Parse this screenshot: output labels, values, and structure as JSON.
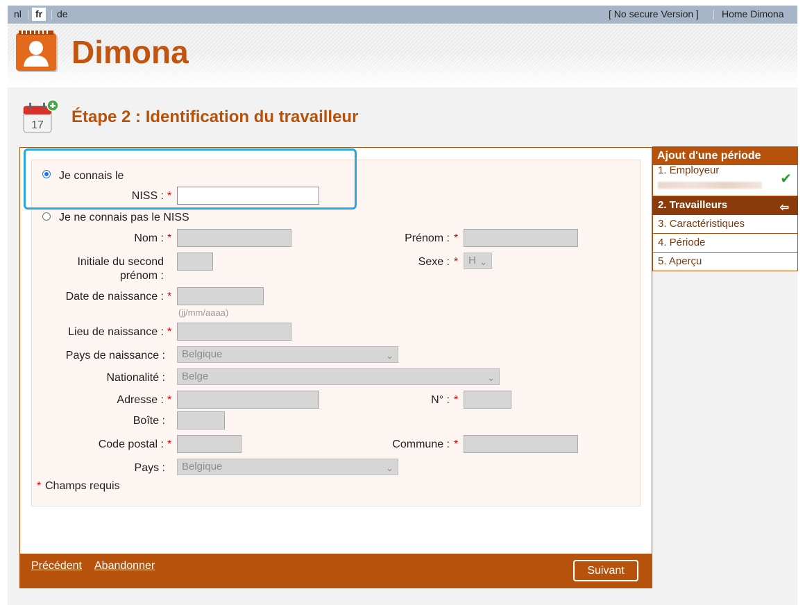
{
  "top_bar": {
    "languages": [
      "nl",
      "fr",
      "de"
    ],
    "active_language": "fr",
    "security_notice": "[ No secure Version ]",
    "home_link": "Home Dimona"
  },
  "brand": {
    "name": "Dimona"
  },
  "step": {
    "title": "Étape 2 : Identification du travailleur",
    "calendar_day": "17"
  },
  "form": {
    "known_niss_label": "Je connais le",
    "niss_label": "NISS :",
    "niss_value": "",
    "unknown_niss_label": "Je ne connais pas le NISS",
    "nom_label": "Nom :",
    "prenom_label": "Prénom :",
    "initial_label_1": "Initiale du second",
    "initial_label_2": "prénom :",
    "sexe_label": "Sexe :",
    "sexe_value": "H",
    "dob_label": "Date de naissance :",
    "dob_hint": "(jj/mm/aaaa)",
    "birthplace_label": "Lieu de naissance :",
    "birth_country_label": "Pays de naissance :",
    "birth_country_value": "Belgique",
    "nationality_label": "Nationalité :",
    "nationality_value": "Belge",
    "address_label": "Adresse :",
    "number_label": "N° :",
    "box_label": "Boîte :",
    "postal_label": "Code postal :",
    "commune_label": "Commune :",
    "country_label": "Pays :",
    "country_value": "Belgique",
    "required_asterisk": "*",
    "required_note": "Champs requis"
  },
  "footer": {
    "previous": "Précédent",
    "abandon": "Abandonner",
    "next": "Suivant"
  },
  "sidebar": {
    "title": "Ajout d'une période",
    "items": [
      {
        "label": "1. Employeur",
        "state": "done"
      },
      {
        "label": "2. Travailleurs",
        "state": "active"
      },
      {
        "label": "3. Caractéristiques",
        "state": "todo"
      },
      {
        "label": "4. Période",
        "state": "todo"
      },
      {
        "label": "5. Aperçu",
        "state": "todo"
      }
    ]
  },
  "colors": {
    "brand": "#b7520d",
    "topbar": "#a6b5c8",
    "highlight": "#26a9e0"
  }
}
